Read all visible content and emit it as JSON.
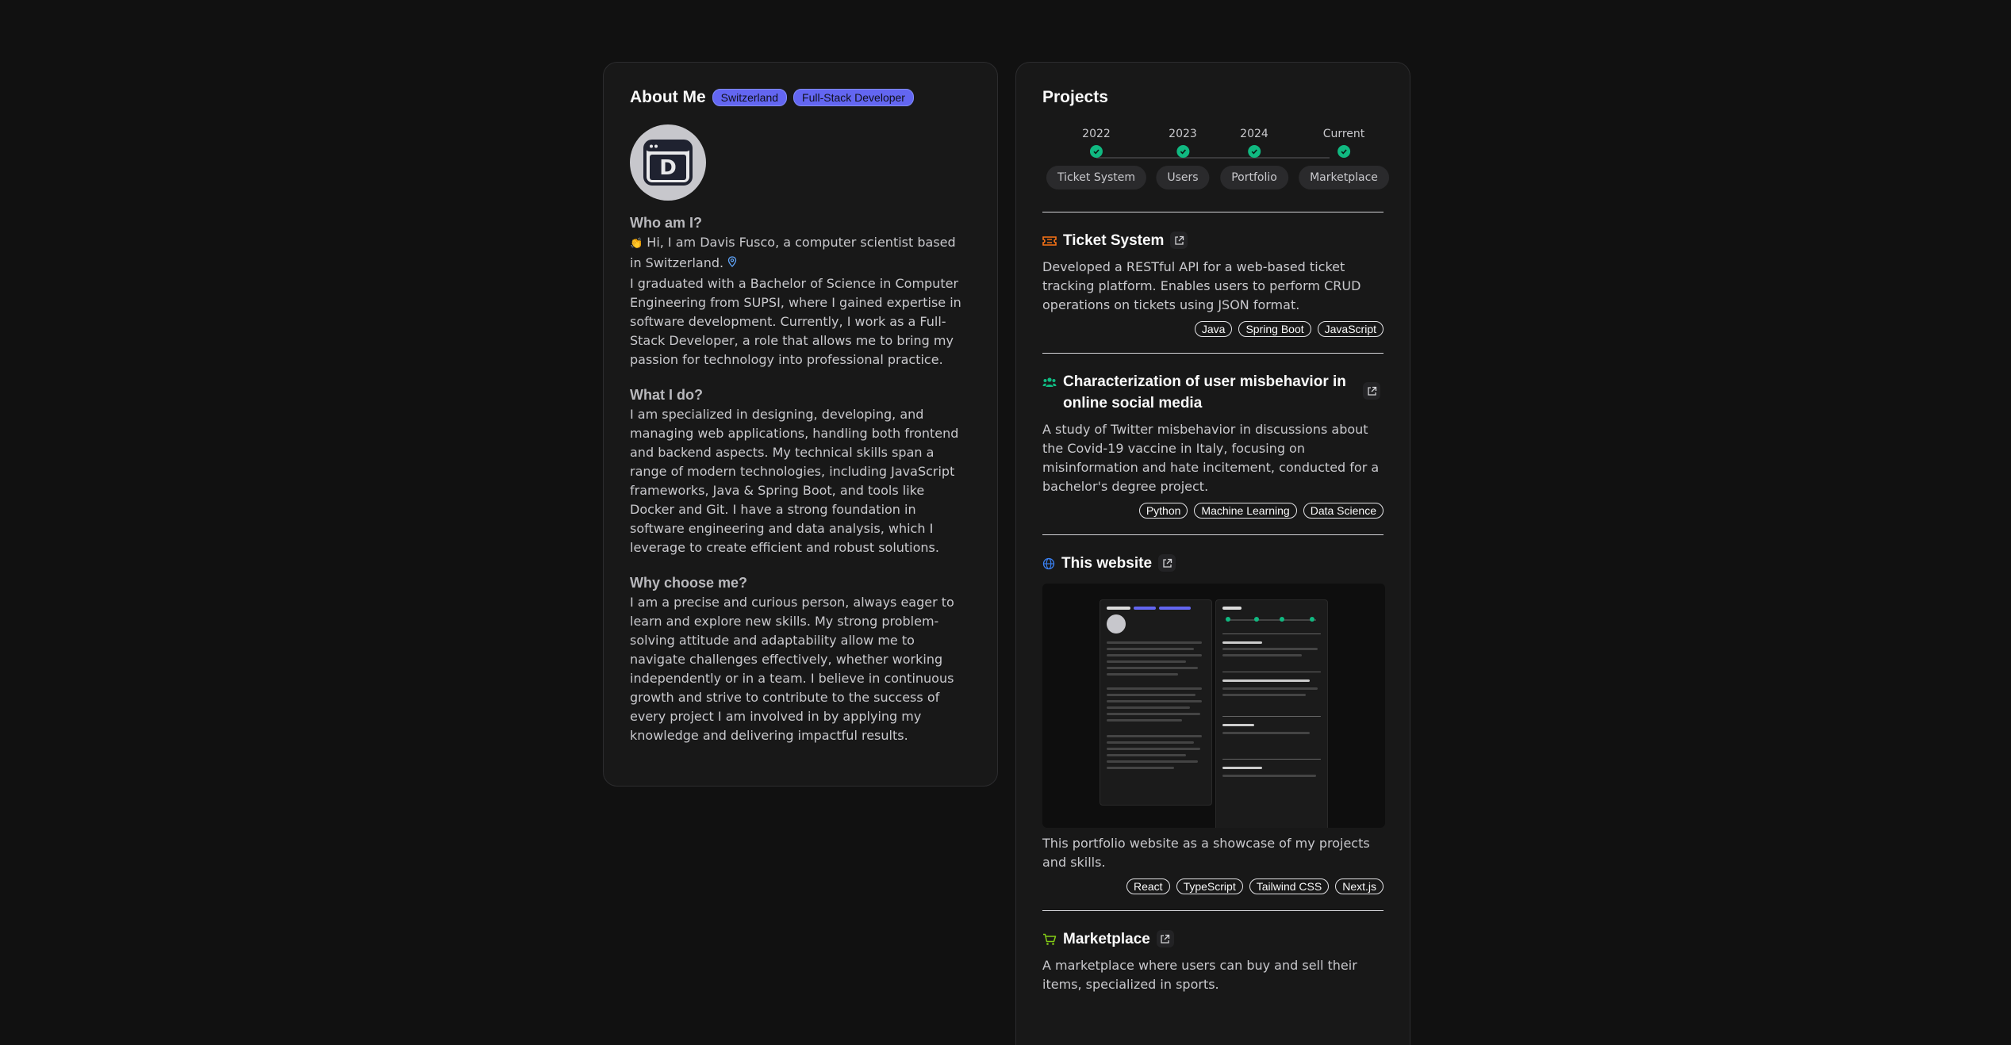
{
  "about": {
    "title": "About Me",
    "badges": [
      "Switzerland",
      "Full-Stack Developer"
    ],
    "avatar_letter": "D",
    "sections": [
      {
        "heading": "Who am I?",
        "intro_emoji": "👏",
        "intro": "Hi, I am Davis Fusco, a computer scientist based in Switzerland.",
        "body": "I graduated with a Bachelor of Science in Computer Engineering from SUPSI, where I gained expertise in software development. Currently, I work as a Full-Stack Developer, a role that allows me to bring my passion for technology into professional practice."
      },
      {
        "heading": "What I do?",
        "body": "I am specialized in designing, developing, and managing web applications, handling both frontend and backend aspects. My technical skills span a range of modern technologies, including JavaScript frameworks, Java & Spring Boot, and tools like Docker and Git. I have a strong foundation in software engineering and data analysis, which I leverage to create efficient and robust solutions."
      },
      {
        "heading": "Why choose me?",
        "body": "I am a precise and curious person, always eager to learn and explore new skills. My strong problem-solving attitude and adaptability allow me to navigate challenges effectively, whether working independently or in a team. I believe in continuous growth and strive to contribute to the success of every project I am involved in by applying my knowledge and delivering impactful results."
      }
    ]
  },
  "projects": {
    "title": "Projects",
    "timeline": [
      {
        "year": "2022",
        "label": "Ticket System"
      },
      {
        "year": "2023",
        "label": "Users"
      },
      {
        "year": "2024",
        "label": "Portfolio"
      },
      {
        "year": "Current",
        "label": "Marketplace"
      }
    ],
    "items": [
      {
        "icon": "ticket-icon",
        "title": "Ticket System",
        "description": "Developed a RESTful API for a web-based ticket tracking platform. Enables users to perform CRUD operations on tickets using JSON format.",
        "tags": [
          "Java",
          "Spring Boot",
          "JavaScript"
        ]
      },
      {
        "icon": "users-icon",
        "title": "Characterization of user misbehavior in online social media",
        "description": "A study of Twitter misbehavior in discussions about the Covid-19 vaccine in Italy, focusing on misinformation and hate incitement, conducted for a bachelor's degree project.",
        "tags": [
          "Python",
          "Machine Learning",
          "Data Science"
        ]
      },
      {
        "icon": "globe-icon",
        "title": "This website",
        "description": "This portfolio website as a showcase of my projects and skills.",
        "tags": [
          "React",
          "TypeScript",
          "Tailwind CSS",
          "Next.js"
        ]
      },
      {
        "icon": "cart-icon",
        "title": "Marketplace",
        "description": "A marketplace where users can buy and sell their items, specialized in sports.",
        "tags": []
      }
    ]
  },
  "colors": {
    "background": "#111111",
    "card": "#181818",
    "badge": "#6366f1",
    "timeline_check": "#10b981",
    "ticket_icon": "#f97316",
    "users_icon": "#10b981",
    "globe_icon": "#3b82f6",
    "cart_icon": "#84cc16"
  }
}
